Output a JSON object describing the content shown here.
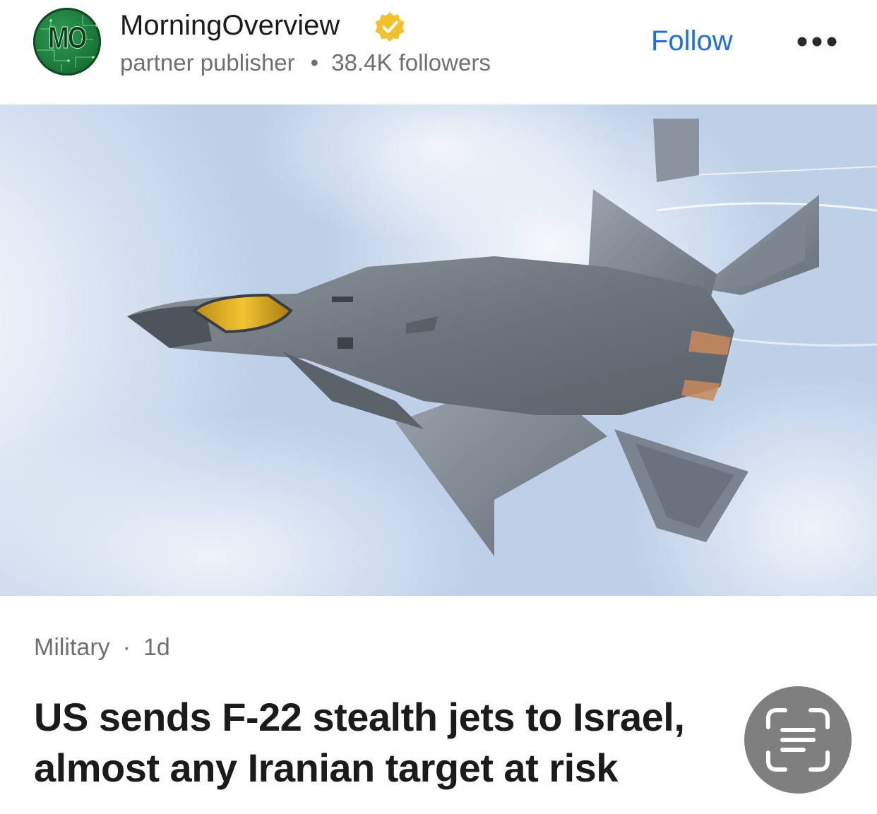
{
  "publisher": {
    "avatar_text": "MO",
    "name": "MorningOverview",
    "role": "partner publisher",
    "followers": "38.4K followers",
    "verified_icon": "verified-badge-icon",
    "follow_label": "Follow",
    "more_icon": "more-dots-icon"
  },
  "article": {
    "image_alt": "F-22 stealth jet in flight",
    "category": "Military",
    "age": "1d",
    "headline_line1": "US sends F-22 stealth jets to Israel,",
    "headline_line2": "almost any Iranian target at risk"
  },
  "overlay": {
    "scan_icon": "text-scan-icon"
  },
  "colors": {
    "accent": "#1d6fe0",
    "verified": "#f2c12e",
    "muted": "#707070"
  }
}
